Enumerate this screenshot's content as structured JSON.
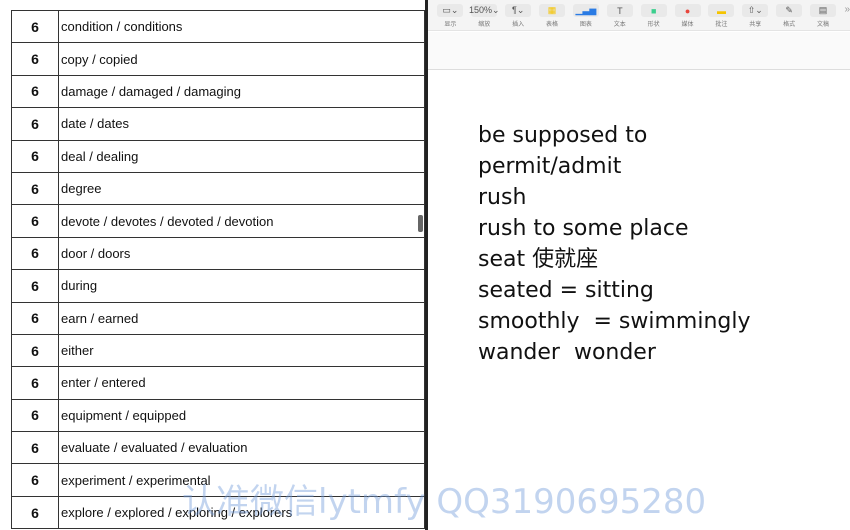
{
  "table": {
    "rows": [
      [
        "6",
        "condition / conditions"
      ],
      [
        "6",
        "copy / copied"
      ],
      [
        "6",
        "damage / damaged / damaging"
      ],
      [
        "6",
        "date / dates"
      ],
      [
        "6",
        "deal / dealing"
      ],
      [
        "6",
        "degree"
      ],
      [
        "6",
        "devote / devotes / devoted / devotion"
      ],
      [
        "6",
        "door / doors"
      ],
      [
        "6",
        "during"
      ],
      [
        "6",
        "earn / earned"
      ],
      [
        "6",
        "either"
      ],
      [
        "6",
        "enter / entered"
      ],
      [
        "6",
        "equipment / equipped"
      ],
      [
        "6",
        "evaluate / evaluated / evaluation"
      ],
      [
        "6",
        "experiment / experimental"
      ],
      [
        "6",
        "explore / explored / exploring / explorers"
      ]
    ]
  },
  "toolbar": {
    "items": [
      {
        "icon": "layout-icon",
        "glyph": "▭⌄",
        "label": "显示"
      },
      {
        "icon": "zoom-icon",
        "glyph": "150%⌄",
        "label": "缩放"
      },
      {
        "icon": "paragraph-icon",
        "glyph": "¶⌄",
        "label": "插入"
      },
      {
        "icon": "table-icon",
        "glyph": "▦",
        "label": "表格"
      },
      {
        "icon": "chart-icon",
        "glyph": "▁▃▅",
        "label": "图表"
      },
      {
        "icon": "text-icon",
        "glyph": "T",
        "label": "文本"
      },
      {
        "icon": "shape-icon",
        "glyph": "■",
        "label": "形状"
      },
      {
        "icon": "media-icon",
        "glyph": "●",
        "label": "媒体"
      },
      {
        "icon": "comment-icon",
        "glyph": "▬",
        "label": "批注"
      },
      {
        "icon": "share-icon",
        "glyph": "⇧⌄",
        "label": "共享"
      },
      {
        "icon": "format-icon",
        "glyph": "✎",
        "label": "格式"
      },
      {
        "icon": "document-icon",
        "glyph": "▤",
        "label": "文稿"
      }
    ],
    "more": "»"
  },
  "notes": [
    "be supposed to",
    "permit/admit",
    "rush",
    "rush to some place",
    "seat 使就座",
    "seated = sitting",
    "smoothly  = swimmingly",
    "wander  wonder"
  ],
  "watermark": "认准微信lytmfy QQ3190695280"
}
